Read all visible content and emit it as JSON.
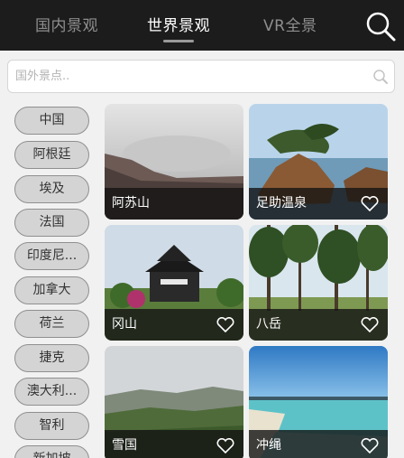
{
  "header": {
    "tabs": [
      {
        "label": "国内景观",
        "active": false
      },
      {
        "label": "世界景观",
        "active": true
      },
      {
        "label": "VR全景",
        "active": false
      }
    ],
    "search_icon": "search-icon"
  },
  "search": {
    "placeholder": "国外景点..",
    "value": "",
    "icon": "search-icon"
  },
  "countries": [
    "中国",
    "阿根廷",
    "埃及",
    "法国",
    "印度尼...",
    "加拿大",
    "荷兰",
    "捷克",
    "澳大利...",
    "智利",
    "新加坡"
  ],
  "places": [
    {
      "name": "阿苏山",
      "favorite_icon": null
    },
    {
      "name": "足助温泉",
      "favorite_icon": "heart-icon"
    },
    {
      "name": "冈山",
      "favorite_icon": "heart-icon"
    },
    {
      "name": "八岳",
      "favorite_icon": "heart-icon"
    },
    {
      "name": "雪国",
      "favorite_icon": "heart-icon"
    },
    {
      "name": "冲绳",
      "favorite_icon": "heart-icon"
    }
  ],
  "colors": {
    "header_bg": "#1c1c1c",
    "tab_active": "#ffffff",
    "tab_inactive": "#8e8e8e",
    "page_bg": "#f1f1f1",
    "chip_bg": "#d4d4d4"
  }
}
